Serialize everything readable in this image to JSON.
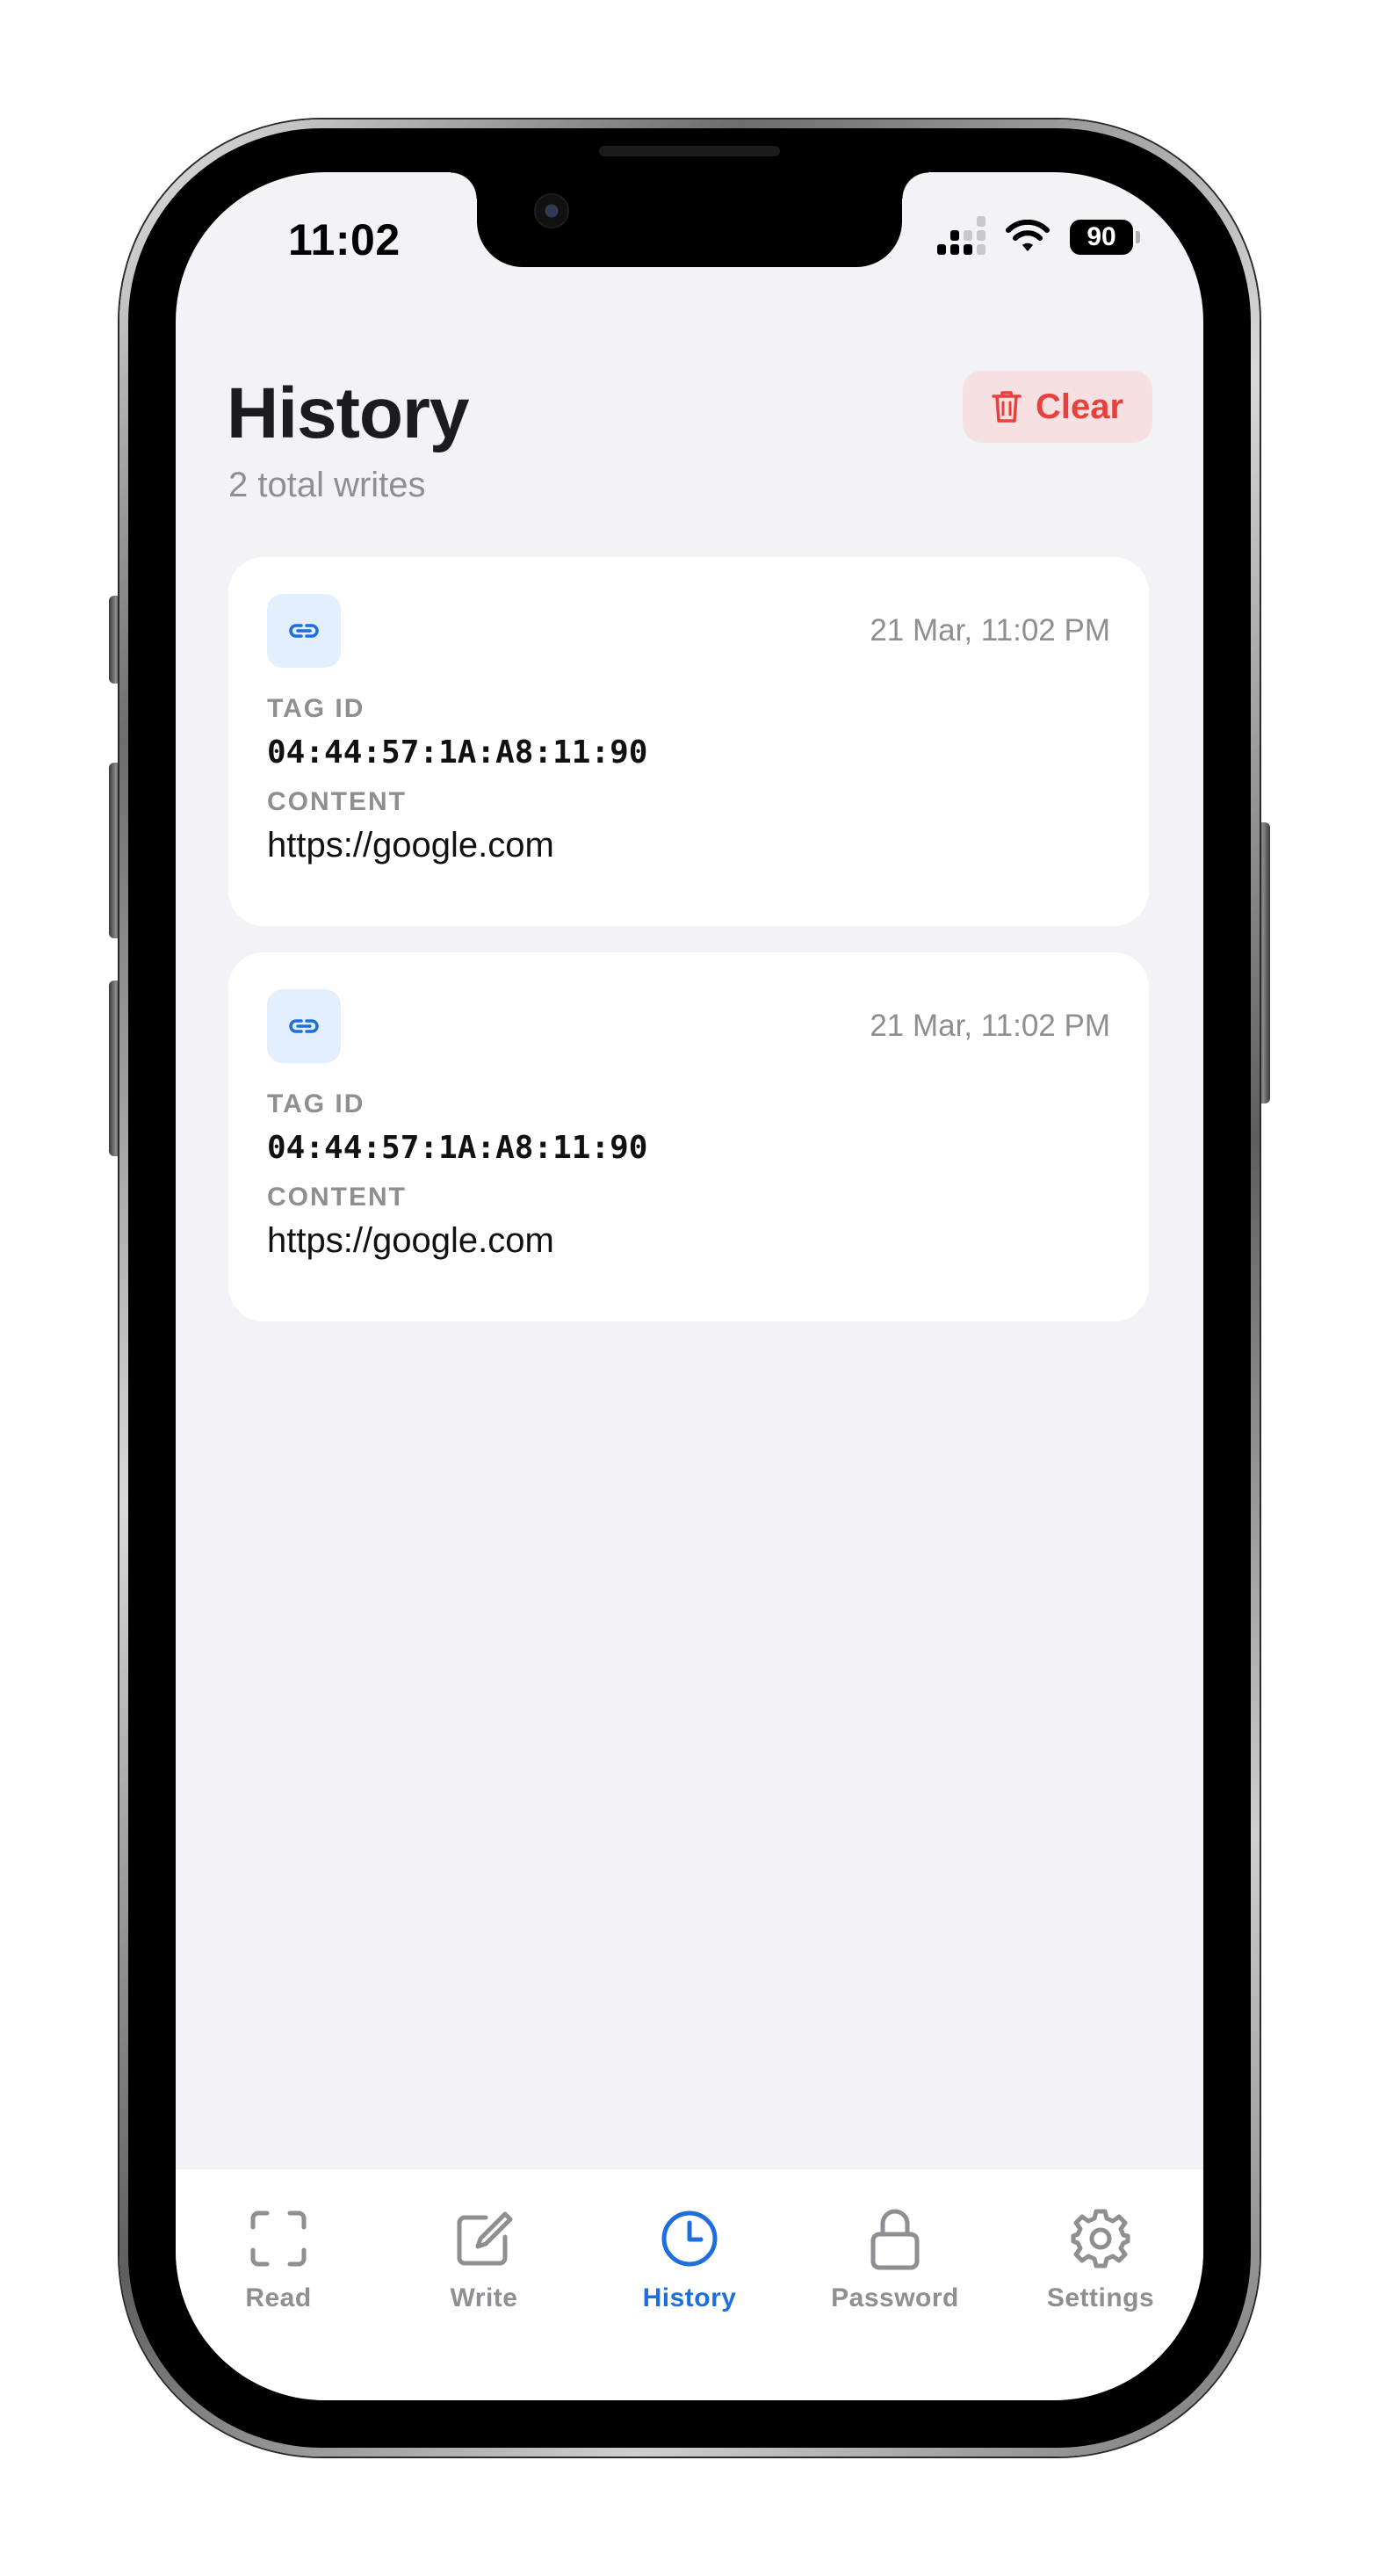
{
  "status_bar": {
    "time": "11:02",
    "battery": "90"
  },
  "header": {
    "title": "History",
    "subtitle": "2 total writes",
    "clear_label": "Clear"
  },
  "labels": {
    "tag_id": "TAG ID",
    "content": "CONTENT"
  },
  "entries": [
    {
      "type_icon": "link-icon",
      "date": "21 Mar, 11:02 PM",
      "tag_id": "04:44:57:1A:A8:11:90",
      "content": "https://google.com"
    },
    {
      "type_icon": "link-icon",
      "date": "21 Mar, 11:02 PM",
      "tag_id": "04:44:57:1A:A8:11:90",
      "content": "https://google.com"
    }
  ],
  "tabs": [
    {
      "label": "Read",
      "icon": "scan-icon",
      "active": false
    },
    {
      "label": "Write",
      "icon": "edit-icon",
      "active": false
    },
    {
      "label": "History",
      "icon": "clock-icon",
      "active": true
    },
    {
      "label": "Password",
      "icon": "lock-icon",
      "active": false
    },
    {
      "label": "Settings",
      "icon": "gear-icon",
      "active": false
    }
  ],
  "colors": {
    "accent": "#1e6fde",
    "destructive": "#e8403b",
    "destructive_bg": "#f7e0e2",
    "background": "#f2f2f7",
    "secondary_text": "#8e8e93"
  }
}
